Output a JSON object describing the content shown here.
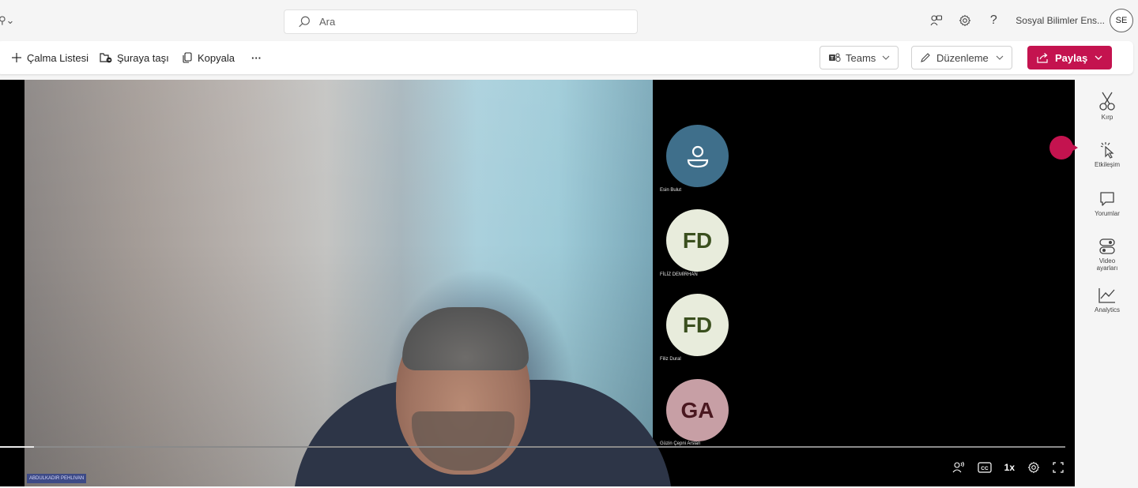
{
  "topbar": {
    "search_placeholder": "Ara",
    "tenant_name": "Sosyal Bilimler Ens...",
    "avatar_initials": "SE",
    "help_glyph": "?"
  },
  "commands": {
    "playlist": "Çalma Listesi",
    "move": "Şuraya taşı",
    "copy": "Kopyala",
    "more": "···"
  },
  "actions": {
    "teams": "Teams",
    "edit": "Düzenleme",
    "share": "Paylaş",
    "share_color": "#c4134f"
  },
  "video": {
    "speaker_tag": "ABDULKADIR PEHLIVAN",
    "playback_speed": "1x",
    "progress_fraction": 0.032,
    "participants": [
      {
        "initials": "",
        "name": "Esin Bulut",
        "bg": "#3f6f8b",
        "fg": "#ffffff",
        "icon": "person-icon"
      },
      {
        "initials": "FD",
        "name": "FİLİZ DEMİRHAN",
        "bg": "#e8ecdc",
        "fg": "#3a4f1e"
      },
      {
        "initials": "FD",
        "name": "Filiz Dural",
        "bg": "#e8ecdc",
        "fg": "#3a4f1e"
      },
      {
        "initials": "GA",
        "name": "Güzin Çepni Arslan",
        "bg": "#c79fa5",
        "fg": "#4a1820"
      }
    ]
  },
  "side_panel": [
    {
      "label": "Kırp",
      "icon": "scissors-icon"
    },
    {
      "label": "Etkileşim",
      "icon": "interaction-icon"
    },
    {
      "label": "Yorumlar",
      "icon": "comment-icon"
    },
    {
      "label": "Video ayarları",
      "icon": "video-settings-icon"
    },
    {
      "label": "Analytics",
      "icon": "analytics-icon"
    }
  ]
}
